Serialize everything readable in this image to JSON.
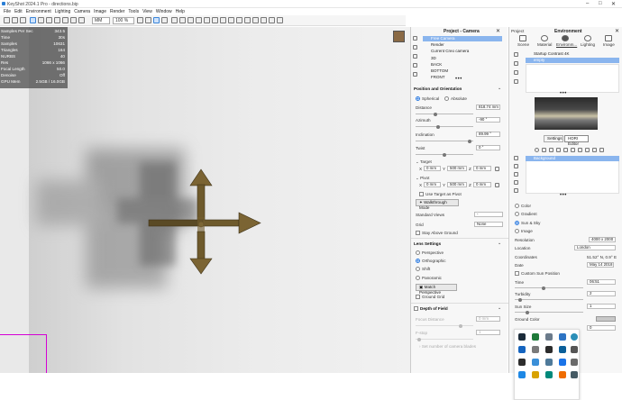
{
  "window": {
    "title": "KeyShot 2024.1 Pro - directions.bip"
  },
  "menu": [
    "File",
    "Edit",
    "Environment",
    "Lighting",
    "Camera",
    "Image",
    "Render",
    "Tools",
    "View",
    "Window",
    "Help"
  ],
  "toolbar": {
    "unit": "MM",
    "zoom": "100 %"
  },
  "stats": [
    {
      "k": "Samples Per Sec",
      "v": "343.5"
    },
    {
      "k": "Time",
      "v": "30s"
    },
    {
      "k": "Samples",
      "v": "10631"
    },
    {
      "k": "Triangles",
      "v": "164"
    },
    {
      "k": "NURBS",
      "v": "40"
    },
    {
      "k": "Res",
      "v": "1066 x 1066"
    },
    {
      "k": "Focal Length",
      "v": "50.0"
    },
    {
      "k": "Denoise",
      "v": "Off"
    },
    {
      "k": "GPU Mem",
      "v": "2.5GB / 16.0GB"
    }
  ],
  "project_camera": {
    "title": "Project - Camera",
    "cameras": [
      "Free Camera",
      "Render",
      "Current Creo camera",
      "3D",
      "BACK",
      "BOTTOM",
      "FRONT"
    ],
    "position_section": "Position and Orientation",
    "mode_spherical": "Spherical",
    "mode_absolute": "Absolute",
    "distance_label": "Distance",
    "distance": "818.74 mm",
    "azimuth_label": "Azimuth",
    "azimuth": "-90 °",
    "inclination_label": "Inclination",
    "inclination": "89.99 °",
    "twist_label": "Twist",
    "twist": "0 °",
    "target_label": "Target",
    "target": [
      "0 mm",
      "500 mm",
      "0 mm"
    ],
    "pivot_label": "Pivot",
    "pivot": [
      "0 mm",
      "500 mm",
      "0 mm"
    ],
    "use_target_pivot": "Use Target as Pivot",
    "walkthrough": "Walkthrough Mode",
    "standard_views_label": "Standard Views",
    "standard_views": "-",
    "grid_label": "Grid",
    "grid": "None",
    "stay_above": "Stay Above Ground",
    "lens_section": "Lens Settings",
    "lens": [
      "Perspective",
      "Orthographic",
      "Shift",
      "Panoramic"
    ],
    "match_perspective": "Match Perspective",
    "ground_grid": "Ground Grid",
    "dof_section": "Depth of Field",
    "focus_distance_label": "Focus Distance",
    "focus_distance": "0 mm",
    "fstop_label": "F-stop",
    "fstop": "1",
    "blades": "Set number of camera blades",
    "axis_x": "X",
    "axis_y": "Y",
    "axis_z": "Z"
  },
  "environment": {
    "project_label": "Project",
    "title": "Environment",
    "tabs": [
      "Scene",
      "Material",
      "Environm...",
      "Lighting",
      "Image"
    ],
    "env_list": [
      "Startup Contrast 4K",
      "empty"
    ],
    "subtabs": [
      "Settings",
      "HDRI Editor"
    ],
    "layers": [
      "Background"
    ],
    "bg_options": [
      "Color",
      "Gradient",
      "Sun & Sky",
      "Image"
    ],
    "resolution_label": "Resolution",
    "resolution": "4000 x 2000",
    "location_label": "Location",
    "location": "London",
    "coordinates_label": "Coordinates",
    "coordinates": "51.52° N, 0.9° E",
    "date_label": "Date",
    "date": "May 14 2018",
    "custom_sun": "Custom Sun Position",
    "time_label": "Time",
    "time": "06:51",
    "turbidity_label": "Turbidity",
    "turbidity": "2",
    "sun_size_label": "Sun Size",
    "sun_size": "1",
    "ground_color_label": "Ground Color",
    "ground_extra": "0"
  },
  "colors": {
    "accent": "#2d7be0",
    "selection": "#8ab5ee",
    "model": "#7a6330",
    "magenta": "#d400d4"
  }
}
